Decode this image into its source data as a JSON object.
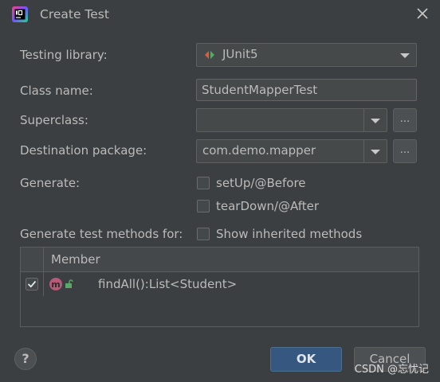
{
  "window": {
    "title": "Create Test"
  },
  "form": {
    "testing_library_label": "Testing library:",
    "testing_library_value": "JUnit5",
    "class_name_label": "Class name:",
    "class_name_value": "StudentMapperTest",
    "superclass_label": "Superclass:",
    "superclass_value": "",
    "destination_label": "Destination package:",
    "destination_value": "com.demo.mapper",
    "browse_label": "...",
    "generate_label": "Generate:",
    "setup_label": "setUp/@Before",
    "teardown_label": "tearDown/@After",
    "methods_label": "Generate test methods for:",
    "inherited_label": "Show inherited methods"
  },
  "table": {
    "header": "Member",
    "rows": [
      {
        "checked": true,
        "text": "findAll():List<Student>"
      }
    ]
  },
  "buttons": {
    "help": "?",
    "ok": "OK",
    "cancel": "Cancel"
  },
  "watermark": "CSDN @忘忧记",
  "icons": {
    "app": "intellij-icon",
    "close": "close-icon",
    "junit": "junit-icon",
    "method": "method-icon",
    "lock": "unlock-icon"
  },
  "colors": {
    "background": "#3c3f41",
    "ok_button": "#365880",
    "field": "#45494a"
  }
}
